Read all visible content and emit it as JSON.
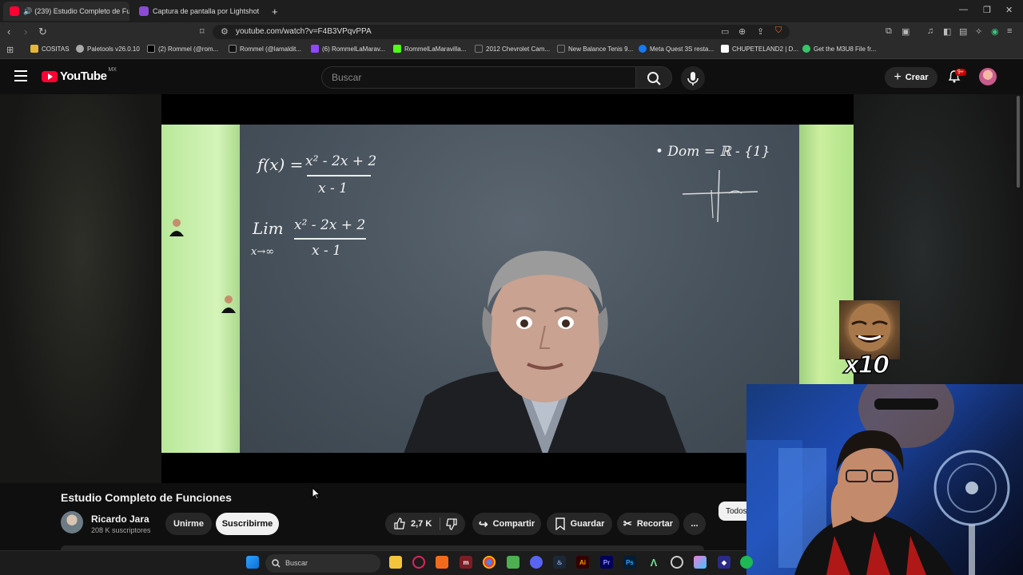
{
  "browser": {
    "tabs": [
      {
        "title": "(239) Estudio Completo de Fu",
        "active": true
      },
      {
        "title": "Captura de pantalla por Lightshot",
        "active": false
      }
    ],
    "new_tab": "+",
    "url": "youtube.com/watch?v=F4B3VPqvPPA",
    "bookmarks": [
      "COSITAS",
      "Paletools v26.0.10",
      "(2) Rommel (@rom...",
      "Rommel (@lamaldit...",
      "(6) RommelLaMarav...",
      "RommelLaMaravilla...",
      "2012 Chevrolet Cam...",
      "New Balance Tenis 9...",
      "Meta Quest 3S resta...",
      "CHUPETELAND2 | D...",
      "Get the M3U8 File fr..."
    ]
  },
  "youtube": {
    "logo_text": "YouTube",
    "country": "MX",
    "search_placeholder": "Buscar",
    "create_label": "Crear",
    "notification_count": "9+",
    "video": {
      "title": "Estudio Completo de Funciones",
      "channel": "Ricardo Jara",
      "subscribers": "208 K suscriptores",
      "join_label": "Unirme",
      "subscribe_label": "Suscribirme",
      "likes": "2,7 K",
      "share_label": "Compartir",
      "save_label": "Guardar",
      "clip_label": "Recortar",
      "more_label": "...",
      "filter_label": "Todos"
    },
    "chalkboard": {
      "func": "f(x) =",
      "numerator": "x² - 2x + 2",
      "denominator": "x - 1",
      "limit": "Lim",
      "limit_sub": "x→∞",
      "limit_num": "x² - 2x + 2",
      "limit_den": "x - 1",
      "domain": "• Dom = ℝ - {1}"
    }
  },
  "overlay": {
    "meme_multiplier": "x10"
  },
  "taskbar": {
    "search_label": "Buscar"
  },
  "colors": {
    "youtube_red": "#ff0033",
    "background": "#0f0f0f",
    "chip_bg": "#272727"
  }
}
